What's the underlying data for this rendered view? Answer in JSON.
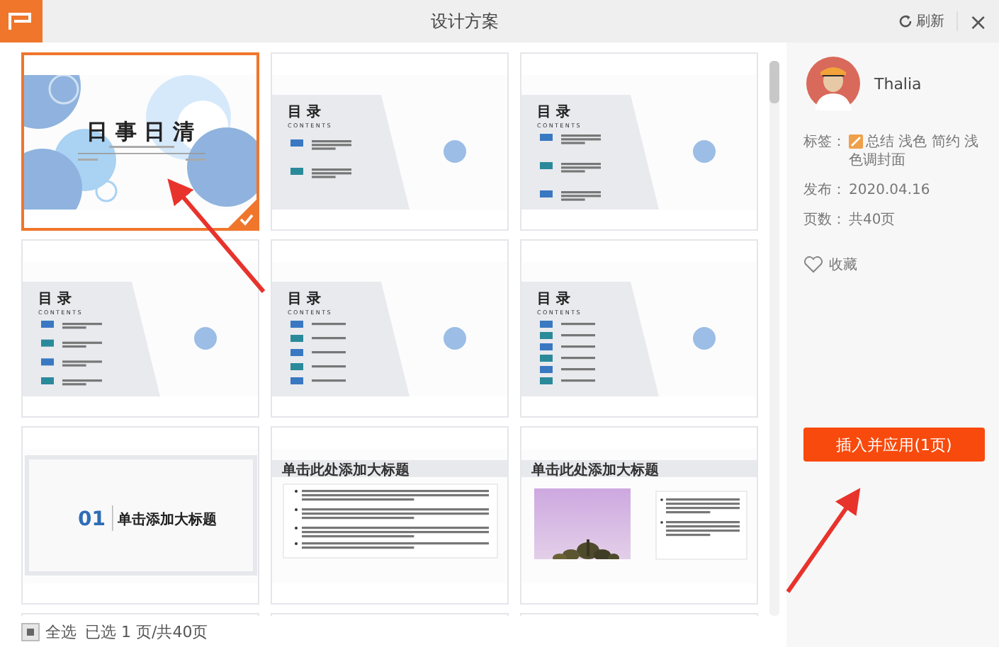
{
  "window": {
    "title": "设计方案",
    "refresh": "刷新",
    "close": "×"
  },
  "slides": [
    {
      "kind": "cover",
      "title": "日 事 日 清",
      "selected": true
    },
    {
      "kind": "contents",
      "title": "目 录",
      "subtitle": "CONTENTS",
      "selected": false,
      "entries": [
        {
          "color": "#3a78c2"
        },
        {
          "color": "#2a8a9a"
        }
      ]
    },
    {
      "kind": "contents",
      "title": "目 录",
      "subtitle": "CONTENTS",
      "selected": false,
      "entries": [
        {
          "color": "#3a78c2"
        },
        {
          "color": "#2a8a9a"
        },
        {
          "color": "#3a78c2"
        }
      ]
    },
    {
      "kind": "contents",
      "title": "目 录",
      "subtitle": "CONTENTS",
      "selected": false,
      "entries": [
        {
          "color": "#3a78c2"
        },
        {
          "color": "#2a8a9a"
        },
        {
          "color": "#3a78c2"
        },
        {
          "color": "#2a8a9a"
        }
      ]
    },
    {
      "kind": "contents",
      "title": "目 录",
      "subtitle": "CONTENTS",
      "selected": false,
      "entries": [
        {
          "color": "#3a78c2"
        },
        {
          "color": "#2a8a9a"
        },
        {
          "color": "#3a78c2"
        },
        {
          "color": "#2a8a9a"
        },
        {
          "color": "#3a78c2"
        }
      ]
    },
    {
      "kind": "contents",
      "title": "目 录",
      "subtitle": "CONTENTS",
      "selected": false,
      "entries": [
        {
          "color": "#3a78c2"
        },
        {
          "color": "#2a8a9a"
        },
        {
          "color": "#3a78c2"
        },
        {
          "color": "#2a8a9a"
        },
        {
          "color": "#3a78c2"
        },
        {
          "color": "#2a8a9a"
        }
      ]
    },
    {
      "kind": "section",
      "number": "01",
      "title": "单击添加大标题",
      "selected": false
    },
    {
      "kind": "text",
      "title": "单击此处添加大标题",
      "selected": false
    },
    {
      "kind": "image-text",
      "title": "单击此处添加大标题",
      "selected": false
    },
    {
      "kind": "cut",
      "selected": false
    },
    {
      "kind": "cut",
      "selected": false
    },
    {
      "kind": "cut",
      "selected": false
    }
  ],
  "details": {
    "author": "Thalia",
    "tags_label": "标签：",
    "tags": "总结 浅色 简约 浅色调封面",
    "published_label": "发布：",
    "published": "2020.04.16",
    "pages_label": "页数：",
    "pages": "共40页",
    "favorite": "收藏",
    "apply_button": "插入并应用(1页)"
  },
  "footer": {
    "select_all": "全选",
    "indeterminate": true,
    "summary": "已选 1 页/共40页"
  }
}
